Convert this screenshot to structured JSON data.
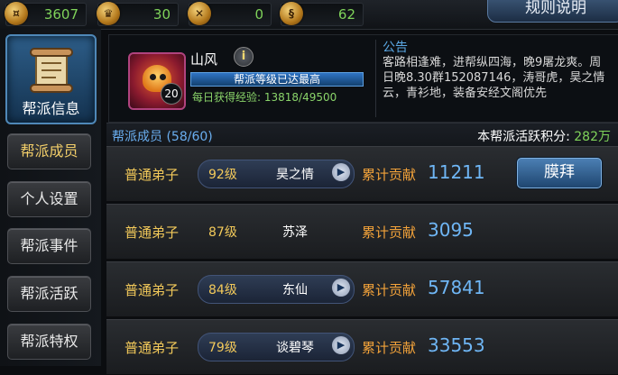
{
  "currencies": [
    {
      "icon": "gold-coin-icon",
      "value": "3607"
    },
    {
      "icon": "helmet-icon",
      "value": "30"
    },
    {
      "icon": "crossed-swords-icon",
      "value": "0"
    },
    {
      "icon": "scroll-medal-icon",
      "value": "62"
    }
  ],
  "rules_label": "规则说明",
  "sidebar": {
    "active": "帮派信息",
    "items": [
      "帮派成员",
      "个人设置",
      "帮派事件",
      "帮派活跃",
      "帮派特权"
    ]
  },
  "guild": {
    "name": "山风",
    "level": "20",
    "level_status": "帮派等级已达最高",
    "exp_text": "每日获得经验: 13818/49500"
  },
  "notice": {
    "title": "公告",
    "text": "客路相逢难，进帮纵四海，晚9屠龙爽。周日晚8.30群152087146，涛哥虎，昊之情云，青衫地，装备安经文阁优先"
  },
  "members_header": {
    "count": "帮派成员 (58/60)",
    "activity_label": "本帮派活跃积分: ",
    "activity_value": "282万"
  },
  "contrib_label": "累计贡献",
  "members": [
    {
      "rank": "普通弟子",
      "level": "92级",
      "name": "昊之情",
      "contrib": "11211",
      "action": "膜拜"
    },
    {
      "rank": "普通弟子",
      "level": "87级",
      "name": "苏泽",
      "contrib": "3095"
    },
    {
      "rank": "普通弟子",
      "level": "84级",
      "name": "东仙",
      "contrib": "57841"
    },
    {
      "rank": "普通弟子",
      "level": "79级",
      "name": "谈碧琴",
      "contrib": "33553"
    }
  ]
}
